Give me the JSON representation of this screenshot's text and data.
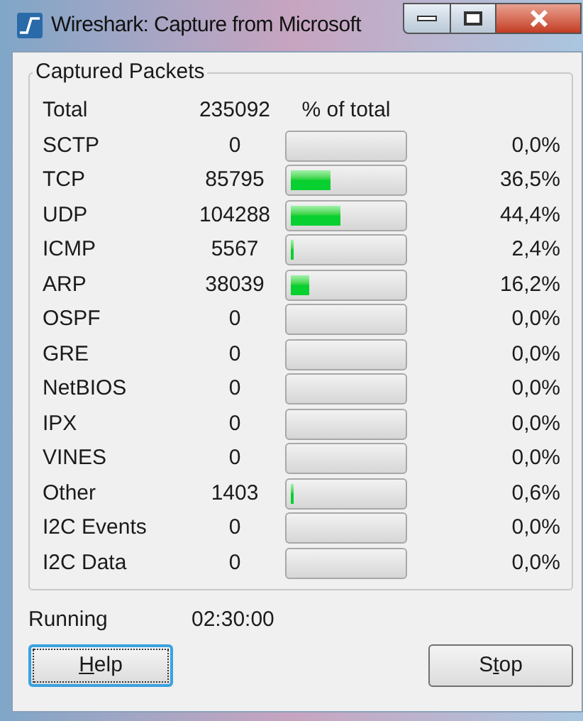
{
  "window": {
    "title": "Wireshark: Capture from Microsoft"
  },
  "group": {
    "title": "Captured Packets",
    "header": {
      "label": "Total",
      "count": "235092",
      "percent_heading": "% of total"
    },
    "rows": [
      {
        "protocol": "SCTP",
        "count": "0",
        "level": 0,
        "percent": "0,0%"
      },
      {
        "protocol": "TCP",
        "count": "85795",
        "level": 0.365,
        "percent": "36,5%"
      },
      {
        "protocol": "UDP",
        "count": "104288",
        "level": 0.444,
        "percent": "44,4%"
      },
      {
        "protocol": "ICMP",
        "count": "5567",
        "level": 0.024,
        "percent": "2,4%"
      },
      {
        "protocol": "ARP",
        "count": "38039",
        "level": 0.162,
        "percent": "16,2%"
      },
      {
        "protocol": "OSPF",
        "count": "0",
        "level": 0,
        "percent": "0,0%"
      },
      {
        "protocol": "GRE",
        "count": "0",
        "level": 0,
        "percent": "0,0%"
      },
      {
        "protocol": "NetBIOS",
        "count": "0",
        "level": 0,
        "percent": "0,0%"
      },
      {
        "protocol": "IPX",
        "count": "0",
        "level": 0,
        "percent": "0,0%"
      },
      {
        "protocol": "VINES",
        "count": "0",
        "level": 0,
        "percent": "0,0%"
      },
      {
        "protocol": "Other",
        "count": "1403",
        "level": 0.006,
        "percent": "0,6%"
      },
      {
        "protocol": "I2C Events",
        "count": "0",
        "level": 0,
        "percent": "0,0%"
      },
      {
        "protocol": "I2C Data",
        "count": "0",
        "level": 0,
        "percent": "0,0%"
      }
    ]
  },
  "status": {
    "label": "Running",
    "time": "02:30:00"
  },
  "buttons": [
    {
      "access_key": "H",
      "after": "elp",
      "focused": true
    },
    {
      "before": "S",
      "access_key": "t",
      "after": "op",
      "focused": false
    }
  ]
}
